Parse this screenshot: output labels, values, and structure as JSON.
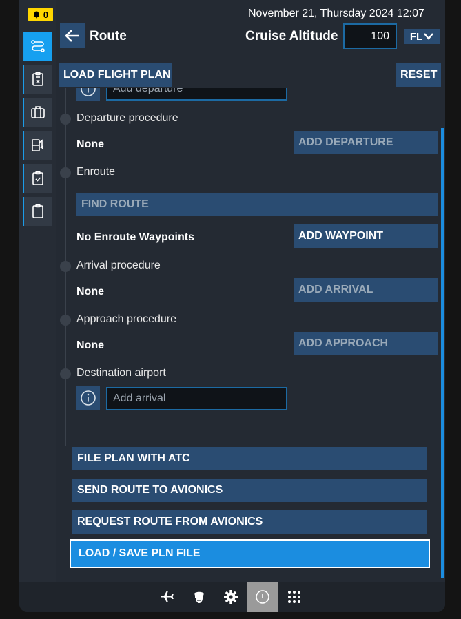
{
  "notifications": {
    "count": "0"
  },
  "header": {
    "datetime": "November 21, Thursday 2024 12:07",
    "title": "Route",
    "altitude_label": "Cruise Altitude",
    "altitude_value": "100",
    "altitude_unit": "FL"
  },
  "toolbar": {
    "load_flight_plan": "LOAD FLIGHT PLAN",
    "reset": "RESET"
  },
  "route": {
    "departure_airport_placeholder": "Add departure",
    "departure_procedure": {
      "label": "Departure procedure",
      "value": "None",
      "action": "ADD DEPARTURE"
    },
    "enroute": {
      "label": "Enroute",
      "find_route": "FIND ROUTE",
      "value": "No Enroute Waypoints",
      "action": "ADD WAYPOINT"
    },
    "arrival_procedure": {
      "label": "Arrival procedure",
      "value": "None",
      "action": "ADD ARRIVAL"
    },
    "approach_procedure": {
      "label": "Approach procedure",
      "value": "None",
      "action": "ADD APPROACH"
    },
    "destination_airport": {
      "label": "Destination airport",
      "placeholder": "Add arrival"
    }
  },
  "actions": {
    "file_plan": "FILE PLAN WITH ATC",
    "send_route": "SEND ROUTE TO AVIONICS",
    "request_route": "REQUEST ROUTE FROM AVIONICS",
    "load_save": "LOAD / SAVE PLN FILE"
  },
  "colors": {
    "accent": "#1b8de0",
    "button": "#2a4c72",
    "panel": "#242a33",
    "notification": "#ffd600"
  },
  "icons": {
    "rail": [
      "route-icon",
      "checklist-x-icon",
      "briefcase-icon",
      "fuel-icon",
      "clipboard-check-icon",
      "clipboard-icon"
    ],
    "bottom": [
      "airplane-icon",
      "pilot-icon",
      "gear-icon",
      "power-icon",
      "apps-grid-icon"
    ]
  }
}
